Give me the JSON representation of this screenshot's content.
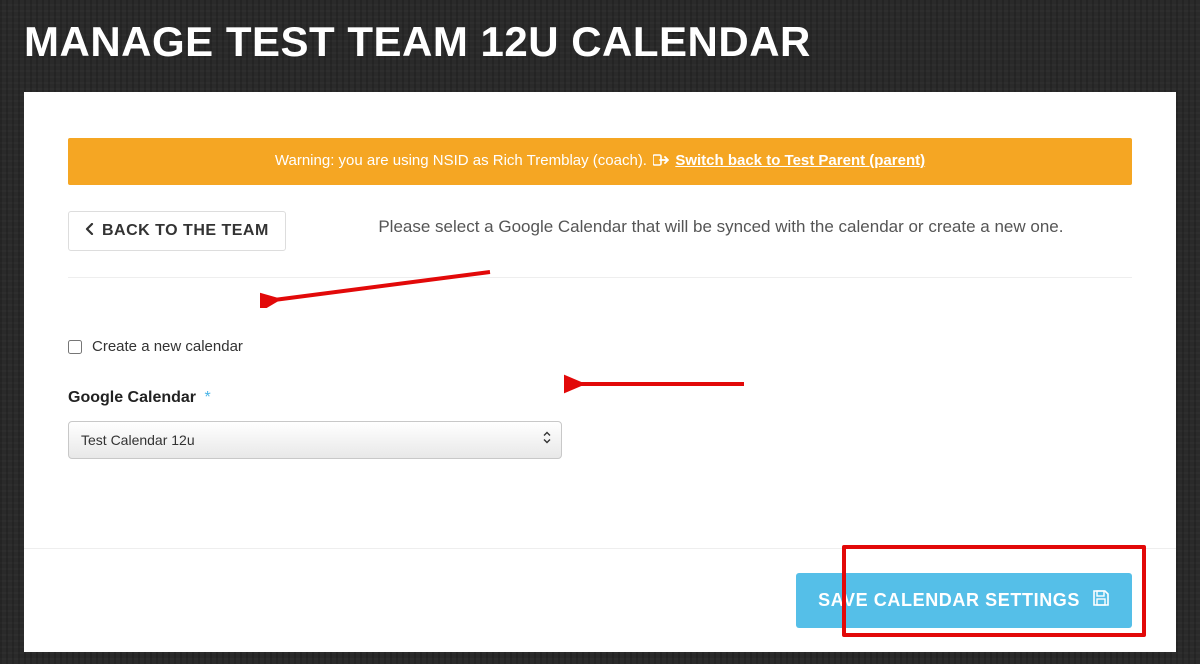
{
  "page": {
    "title": "MANAGE TEST TEAM 12U CALENDAR"
  },
  "warning": {
    "prefix": "Warning: you are using NSID as Rich Tremblay (coach).",
    "link_text": "Switch back to Test Parent (parent)"
  },
  "back_button": {
    "label": "BACK TO THE TEAM"
  },
  "instruction": "Please select a Google Calendar that will be synced with the calendar or create a new one.",
  "form": {
    "create_checkbox_label": "Create a new calendar",
    "create_checkbox_checked": false,
    "google_calendar_label": "Google Calendar",
    "required_indicator": "*",
    "select_value": "Test Calendar 12u"
  },
  "save_button": {
    "label": "SAVE CALENDAR SETTINGS"
  },
  "colors": {
    "warning_bg": "#f5a623",
    "primary_button": "#55bfe8",
    "annotation_red": "#e20909"
  }
}
